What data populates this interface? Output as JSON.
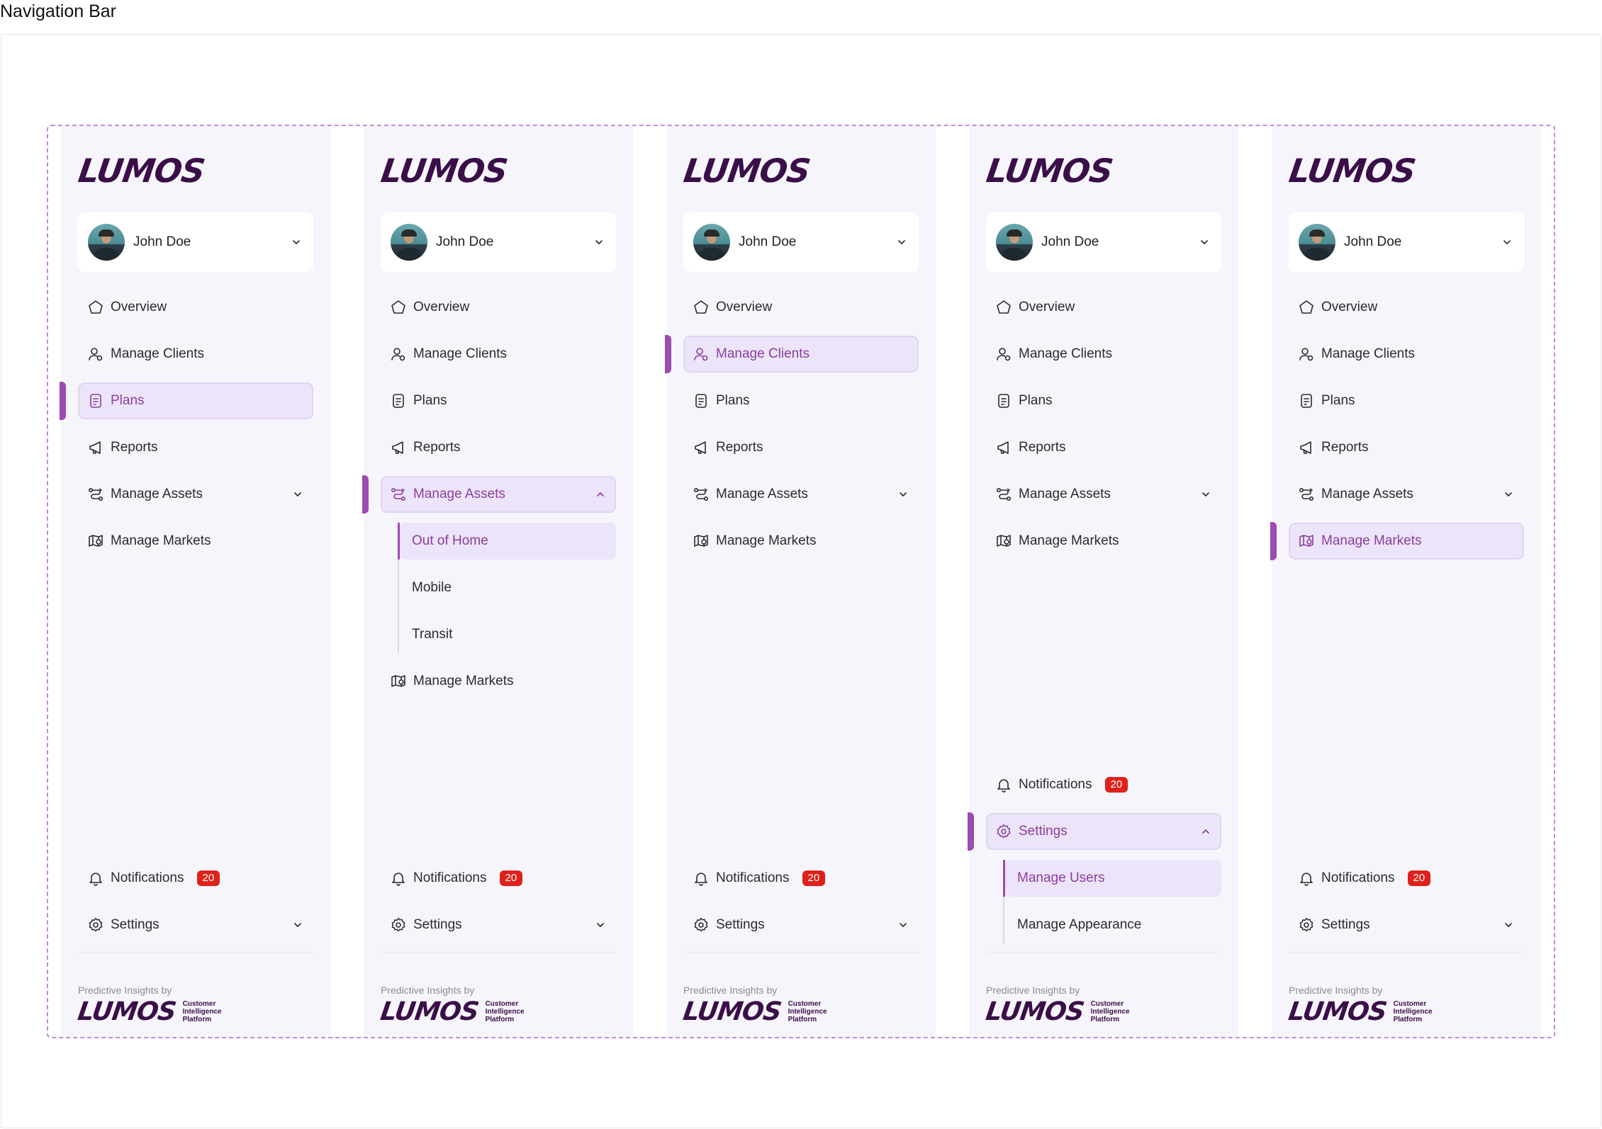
{
  "page_title": "Navigation Bar",
  "logo_text": "LUMOS",
  "user": {
    "name": "John Doe"
  },
  "nav": {
    "overview": "Overview",
    "manage_clients": "Manage Clients",
    "plans": "Plans",
    "reports": "Reports",
    "manage_assets": "Manage Assets",
    "manage_markets": "Manage Markets",
    "notifications": "Notifications",
    "settings": "Settings"
  },
  "assets_sub": [
    "Out of Home",
    "Mobile",
    "Transit"
  ],
  "settings_sub": [
    "Manage Users",
    "Manage Appearance"
  ],
  "notifications_count": "20",
  "footer": {
    "caption": "Predictive Insights by",
    "logo": "LUMOS",
    "tagline": [
      "Customer",
      "Intelligence",
      "Platform"
    ]
  },
  "colors": {
    "accent": "#8a3f9e",
    "active_bg": "#ece4f8",
    "sidebar_bg": "#f7f5fc",
    "badge": "#e0211b",
    "logo": "#3a0f48"
  },
  "variants": [
    {
      "active": "plans"
    },
    {
      "active": "manage_assets",
      "expanded": "manage_assets",
      "active_sub": "Out of Home"
    },
    {
      "active": "manage_clients"
    },
    {
      "active": "settings",
      "expanded": "settings",
      "active_sub": "Manage Users"
    },
    {
      "active": "manage_markets"
    }
  ]
}
